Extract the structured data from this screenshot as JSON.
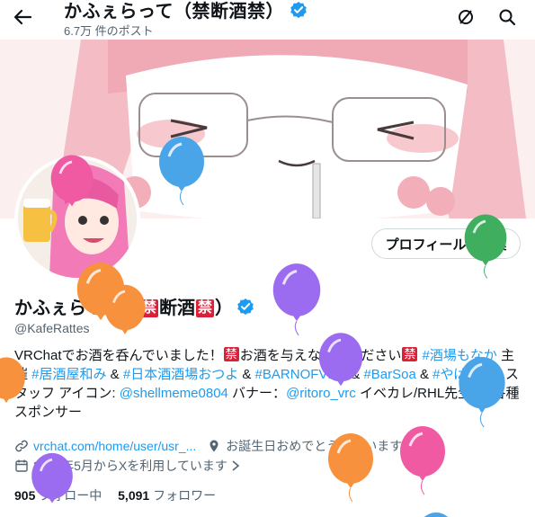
{
  "header": {
    "title": "かふぇらって（禁断酒禁）",
    "post_count": "6.7万 件のポスト"
  },
  "profile": {
    "name_pre": "かふぇらって（",
    "kin": "禁",
    "name_mid": "断酒",
    "name_post": "）",
    "handle": "@KafeRattes",
    "edit_button": "プロフィールを編集"
  },
  "bio": {
    "p1": "VRChatでお酒を呑んでいました！",
    "p2": "お酒を与えないでください",
    "tag1": "#酒場もなか",
    "t1": " 主催 ",
    "tag2": "#居酒屋和み",
    "t2": " & ",
    "tag3": "#日本酒酒場おつよ",
    "t3": " & ",
    "tag4": "#BARNOFVRC",
    "t4": " & ",
    "tag5": "#BarSoa",
    "t5": " & ",
    "tag6": "#やばいBar",
    "t6": " スタッフ アイコン: ",
    "mention1": "@shellmeme0804",
    "t7": " バナー：",
    "mention2": "@ritoro_vrc",
    "t8": " イベカレ/RHL先生/等 各種スポンサー"
  },
  "meta": {
    "website": "vrchat.com/home/user/usr_...",
    "location": "お誕生日おめでとうございます。",
    "joined": "2010年5月からXを利用しています"
  },
  "counts": {
    "following_num": "905",
    "following_label": "フォロー中",
    "followers_num": "5,091",
    "followers_label": "フォロワー"
  },
  "colors": {
    "link": "#1d9bf0",
    "verified": "#1d9bf0",
    "kin_badge": "#d9223a",
    "balloon_purple": "#9b6cf0",
    "balloon_orange": "#f7913d",
    "balloon_blue": "#4aa4e8",
    "balloon_pink": "#ef5aa3",
    "balloon_green": "#3fae5e"
  }
}
